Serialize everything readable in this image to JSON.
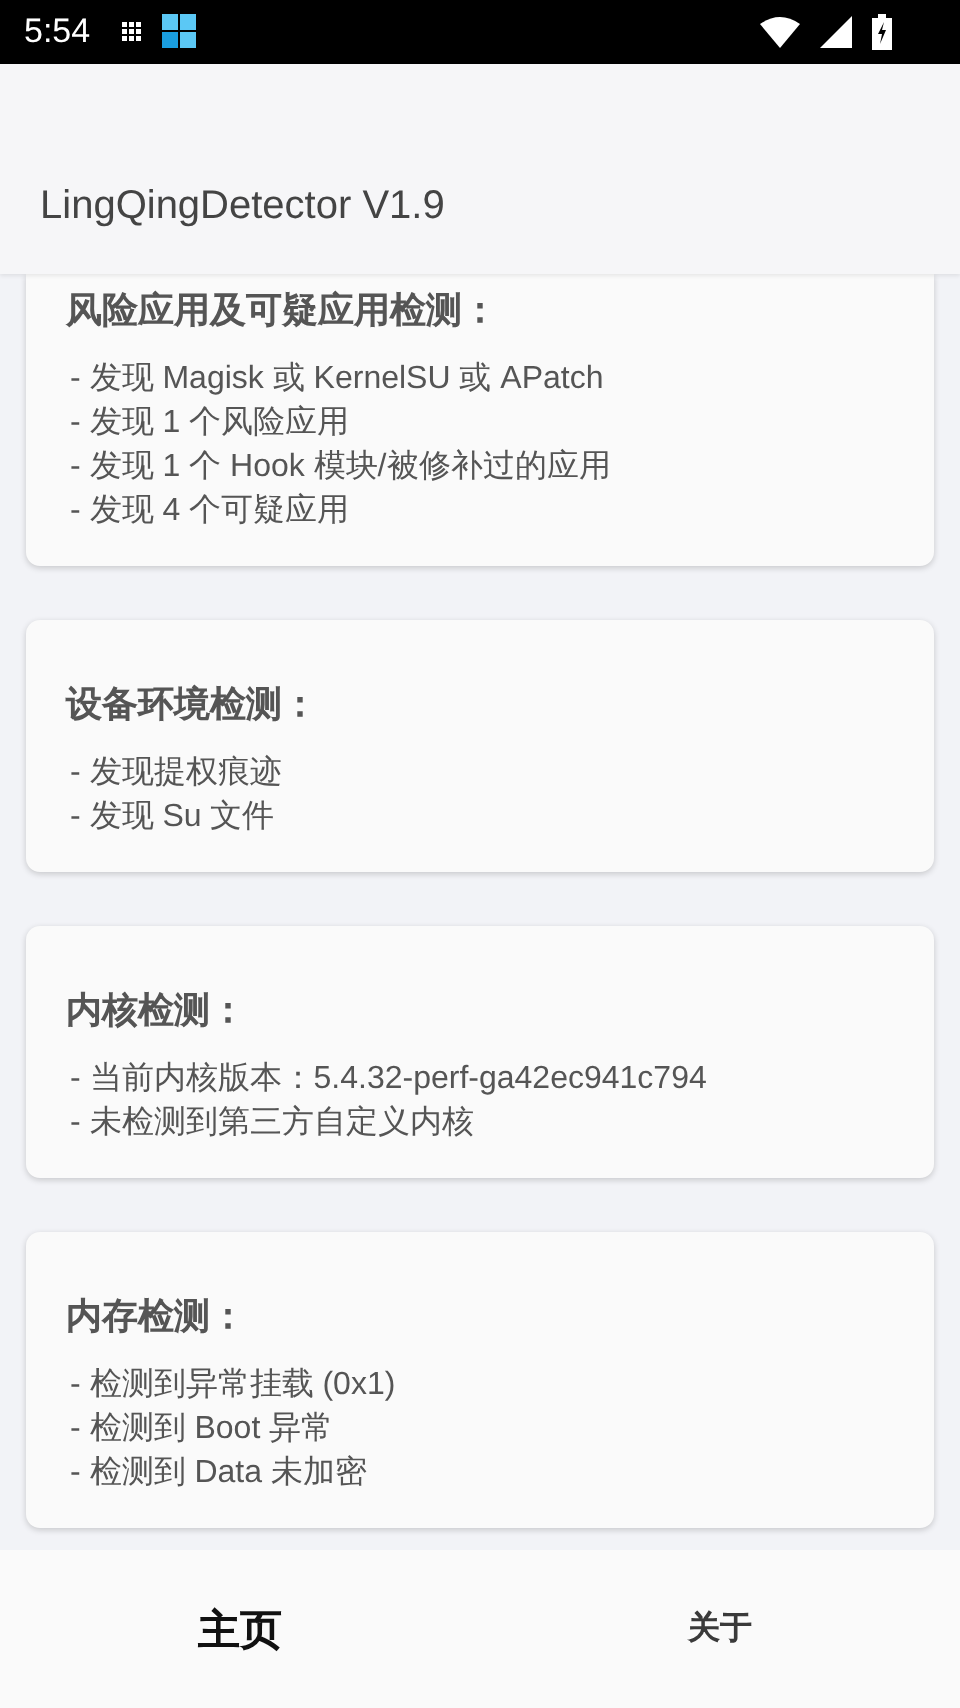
{
  "status_bar": {
    "time": "5:54"
  },
  "app_bar": {
    "title": "LingQingDetector V1.9"
  },
  "cards": [
    {
      "title": "风险应用及可疑应用检测：",
      "lines": [
        "- 发现 Magisk 或 KernelSU 或 APatch",
        "- 发现 1 个风险应用",
        "- 发现 1 个 Hook 模块/被修补过的应用",
        "- 发现 4 个可疑应用"
      ]
    },
    {
      "title": "设备环境检测：",
      "lines": [
        "- 发现提权痕迹",
        "- 发现 Su 文件"
      ]
    },
    {
      "title": "内核检测：",
      "lines": [
        "- 当前内核版本：5.4.32-perf-ga42ec941c794",
        "- 未检测到第三方自定义内核"
      ]
    },
    {
      "title": "内存检测：",
      "lines": [
        "- 检测到异常挂载 (0x1)",
        "- 检测到 Boot 异常",
        "- 检测到 Data 未加密"
      ]
    }
  ],
  "bottom_nav": [
    {
      "label": "主页",
      "selected": true
    },
    {
      "label": "关于",
      "selected": false
    }
  ]
}
